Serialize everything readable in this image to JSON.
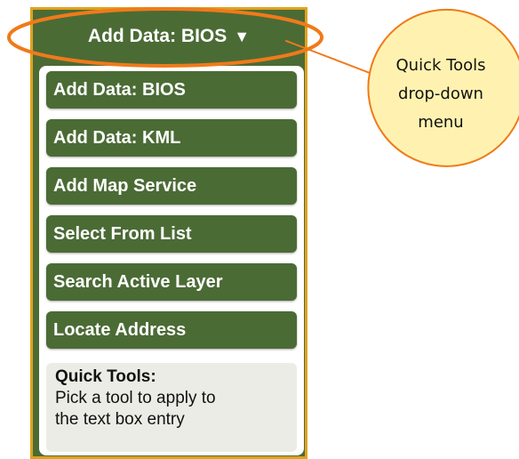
{
  "dropdown": {
    "label": "Add Data: BIOS",
    "arrow": "▼"
  },
  "menu": {
    "items": [
      {
        "label": "Add Data: BIOS"
      },
      {
        "label": "Add Data: KML"
      },
      {
        "label": "Add Map Service"
      },
      {
        "label": "Select From List"
      },
      {
        "label": "Search Active Layer"
      },
      {
        "label": "Locate Address"
      }
    ]
  },
  "info": {
    "title": "Quick Tools:",
    "line1": "Pick a tool to apply to",
    "line2": "the text box entry"
  },
  "callout": {
    "line1": "Quick Tools",
    "line2": "drop-down",
    "line3": "menu"
  },
  "colors": {
    "panel_green": "#4b6b35",
    "panel_border_gold": "#e0a21e",
    "highlight_orange": "#f07a1a",
    "callout_fill": "#fff2b0"
  }
}
